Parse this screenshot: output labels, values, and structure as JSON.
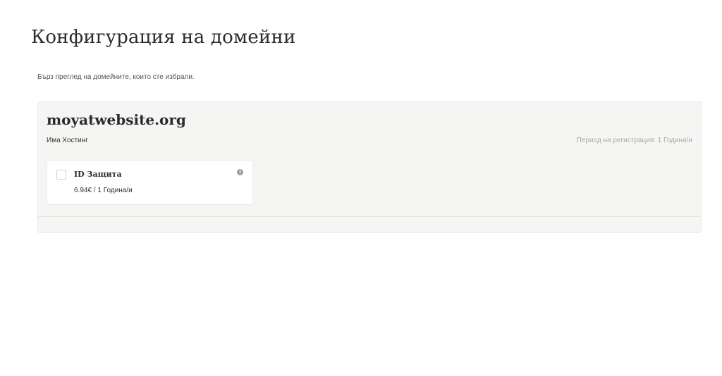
{
  "page": {
    "title": "Конфигурация на домейни",
    "subtitle": "Бърз преглед на домейните, които сте избрали."
  },
  "domain": {
    "name": "moyatwebsite.org",
    "hosting_label": "Има Хостинг",
    "registration_period": "Период на регистрация: 1 Година/и",
    "addons": [
      {
        "title": "ID Защита",
        "price": "6.94€ / 1 Година/и",
        "checked": false,
        "info_icon": "info-icon"
      }
    ]
  },
  "colors": {
    "panel_bg": "#f5f5f4",
    "muted_text": "#a9a9a9",
    "card_bg": "#ffffff"
  }
}
